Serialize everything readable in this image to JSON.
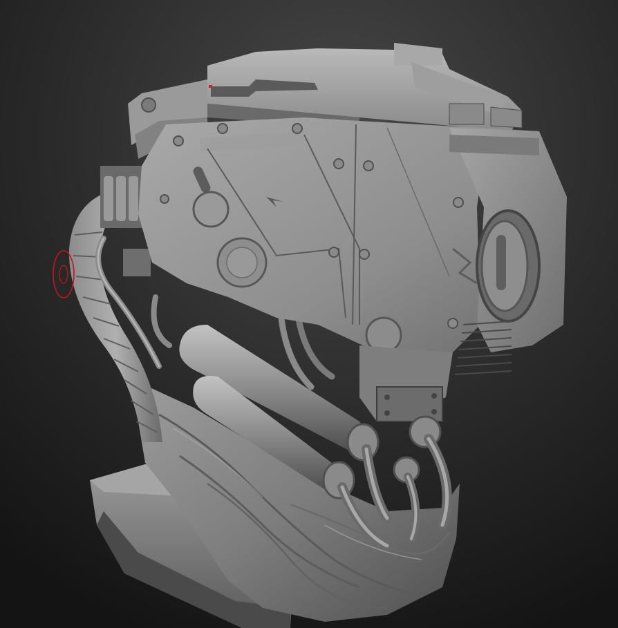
{
  "viewport": {
    "background_top": "#424242",
    "background_bottom": "#151515",
    "mesh_light": "#b5b5b5",
    "mesh_mid": "#7c7c7c",
    "mesh_dark": "#3c3c3c",
    "mesh_shadow": "#262626"
  },
  "brush": {
    "icon": "brush-cursor-icon",
    "color": "#c8141a"
  }
}
